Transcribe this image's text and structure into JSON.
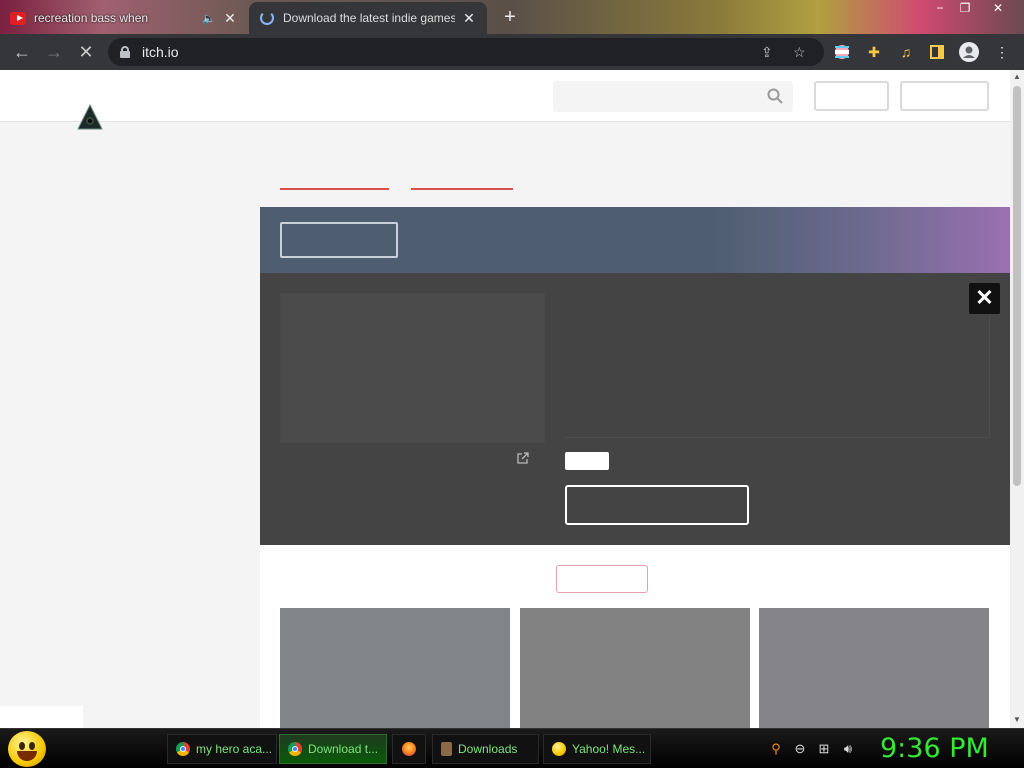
{
  "browser": {
    "tabs": [
      {
        "title": "recreation bass when",
        "active": false,
        "icon": "youtube-icon"
      },
      {
        "title": "Download the latest indie games",
        "active": true,
        "icon": "loading-spinner-icon"
      }
    ],
    "new_tab_symbol": "+",
    "window_controls": {
      "minimize": "−",
      "restore": "❐",
      "close": "✕"
    },
    "url": "itch.io",
    "nav": {
      "back": "←",
      "forward": "→",
      "stop": "✕"
    }
  },
  "site": {
    "close_symbol": "✕"
  },
  "taskbar": {
    "items": [
      {
        "label": "my hero aca...",
        "icon": "chrome-icon",
        "active": false
      },
      {
        "label": "Download t...",
        "icon": "chrome-icon",
        "active": true
      },
      {
        "label": "",
        "icon": "firefox-icon",
        "active": false
      },
      {
        "label": "Downloads",
        "icon": "folder-icon",
        "active": false
      },
      {
        "label": "Yahoo! Mes...",
        "icon": "yahoo-messenger-icon",
        "active": false
      }
    ],
    "clock": "9:36 PM"
  },
  "colors": {
    "accent": "#d84f4f",
    "banner_start": "#4e5e70",
    "banner_end": "#9a70b0",
    "modal_bg": "#444444",
    "clock": "#34e834"
  }
}
